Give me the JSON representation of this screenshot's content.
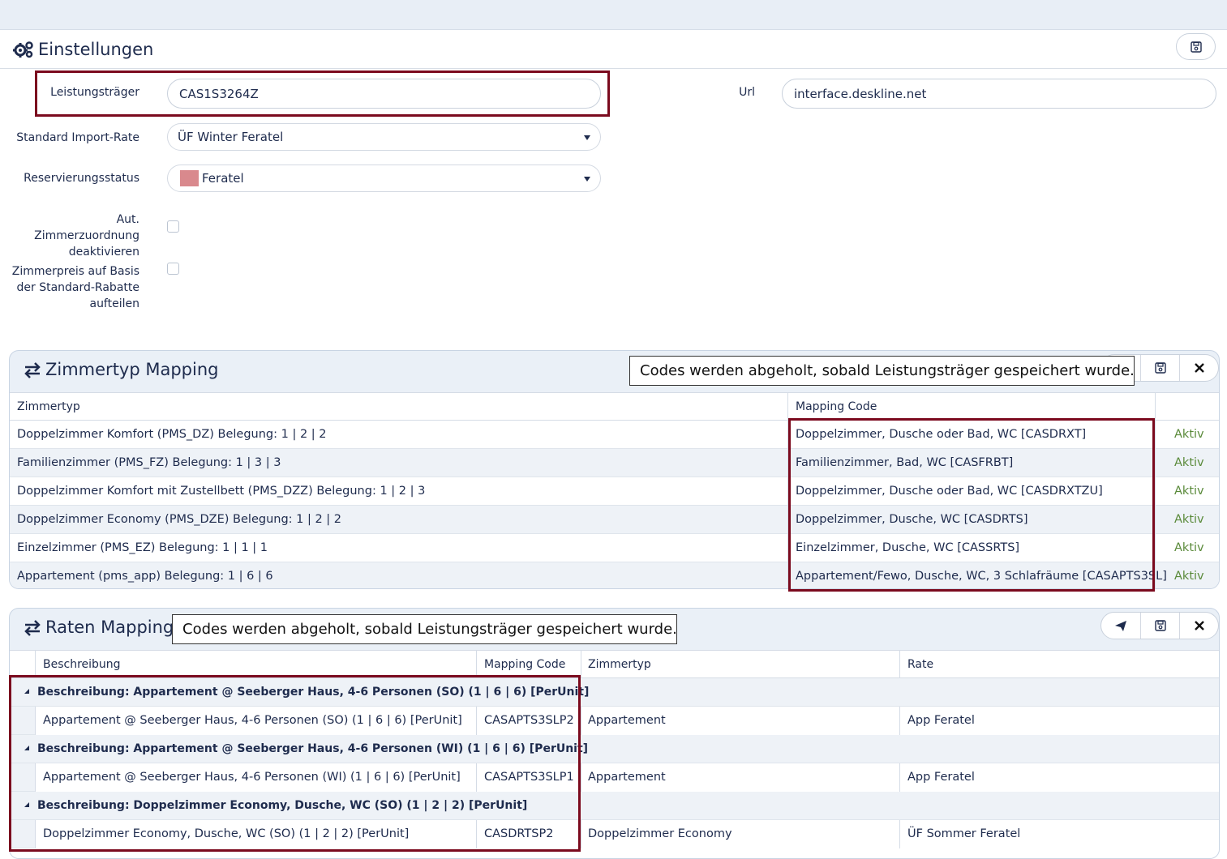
{
  "header": {
    "title": "Einstellungen"
  },
  "form": {
    "leistungstraeger_label": "Leistungsträger",
    "leistungstraeger_value": "CAS1S3264Z",
    "url_label": "Url",
    "url_value": "interface.deskline.net",
    "import_rate_label": "Standard Import-Rate",
    "import_rate_value": "ÜF Winter Feratel",
    "status_label": "Reservierungsstatus",
    "status_value": "Feratel",
    "status_color": "#d9898d",
    "auto_label_1": "Aut. Zimmerzuordnung",
    "auto_label_2": "deaktivieren",
    "preis_label_1": "Zimmerpreis auf Basis",
    "preis_label_2": "der Standard-Rabatte",
    "preis_label_3": "aufteilen"
  },
  "zimmertyp": {
    "title": "Zimmertyp Mapping",
    "tooltip": "Codes werden abgeholt, sobald Leistungsträger gespeichert wurde.",
    "col_zimmertyp": "Zimmertyp",
    "col_mapping": "Mapping Code",
    "rows": [
      {
        "zimmertyp": "Doppelzimmer Komfort (PMS_DZ) Belegung: 1 | 2 | 2",
        "mapping": "Doppelzimmer, Dusche oder Bad, WC [CASDRXT]",
        "status": "Aktiv"
      },
      {
        "zimmertyp": "Familienzimmer (PMS_FZ) Belegung: 1 | 3 | 3",
        "mapping": "Familienzimmer, Bad, WC [CASFRBT]",
        "status": "Aktiv"
      },
      {
        "zimmertyp": "Doppelzimmer Komfort mit Zustellbett (PMS_DZZ) Belegung: 1 | 2 | 3",
        "mapping": "Doppelzimmer, Dusche oder Bad, WC [CASDRXTZU]",
        "status": "Aktiv"
      },
      {
        "zimmertyp": "Doppelzimmer Economy (PMS_DZE) Belegung: 1 | 2 | 2",
        "mapping": "Doppelzimmer, Dusche, WC [CASDRTS]",
        "status": "Aktiv"
      },
      {
        "zimmertyp": "Einzelzimmer (PMS_EZ) Belegung: 1 | 1 | 1",
        "mapping": "Einzelzimmer, Dusche, WC [CASSRTS]",
        "status": "Aktiv"
      },
      {
        "zimmertyp": "Appartement (pms_app) Belegung: 1 | 6 | 6",
        "mapping": "Appartement/Fewo, Dusche, WC, 3 Schlafräume [CASAPTS3SL]",
        "status": "Aktiv"
      }
    ]
  },
  "raten": {
    "title": "Raten Mapping",
    "tooltip": "Codes werden abgeholt, sobald Leistungsträger gespeichert wurde.",
    "col_beschreibung": "Beschreibung",
    "col_mapping": "Mapping Code",
    "col_zimmertyp": "Zimmertyp",
    "col_rate": "Rate",
    "groups": [
      {
        "title": "Beschreibung: Appartement @ Seeberger Haus, 4-6 Personen (SO) (1 | 6 | 6) [PerUnit]",
        "row": {
          "beschreibung": "Appartement @ Seeberger Haus, 4-6 Personen (SO) (1 | 6 | 6) [PerUnit]",
          "mapping": "CASAPTS3SLP2",
          "zimmertyp": "Appartement",
          "rate": "App Feratel"
        }
      },
      {
        "title": "Beschreibung: Appartement @ Seeberger Haus, 4-6 Personen (WI) (1 | 6 | 6) [PerUnit]",
        "row": {
          "beschreibung": "Appartement @ Seeberger Haus, 4-6 Personen (WI) (1 | 6 | 6) [PerUnit]",
          "mapping": "CASAPTS3SLP1",
          "zimmertyp": "Appartement",
          "rate": "App Feratel"
        }
      },
      {
        "title": "Beschreibung: Doppelzimmer Economy, Dusche, WC (SO) (1 | 2 | 2) [PerUnit]",
        "row": {
          "beschreibung": "Doppelzimmer Economy, Dusche, WC (SO) (1 | 2 | 2) [PerUnit]",
          "mapping": "CASDRTSP2",
          "zimmertyp": "Doppelzimmer Economy",
          "rate": "ÜF Sommer Feratel"
        }
      }
    ]
  },
  "icons": {
    "gears": "gears-icon",
    "save": "save-icon",
    "close": "close-icon",
    "send": "paper-plane-icon",
    "exchange": "exchange-icon"
  }
}
